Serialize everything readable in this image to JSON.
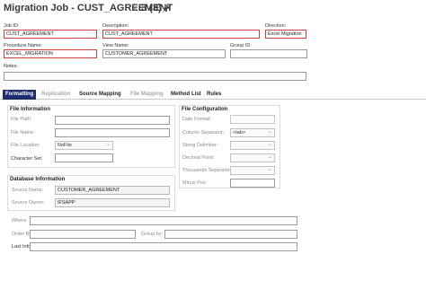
{
  "header": {
    "title": "Migration Job - CUST_AGREEMENT",
    "count": "3 (3)",
    "chevron_icon": "chevron-down-icon",
    "pin_icon": "pin-icon"
  },
  "form": {
    "job_id_label": "Job ID:",
    "job_id_value": "CUST_AGREEMENT",
    "description_label": "Description:",
    "description_value": "CUST_AGREEMENT",
    "direction_label": "Direction:",
    "direction_value": "Excel Migration",
    "procedure_label": "Procedure Name:",
    "procedure_value": "EXCEL_MIGRATION",
    "view_label": "View Name:",
    "view_value": "CUSTOMER_AGREEMENT",
    "group_label": "Group ID:",
    "group_value": "",
    "notes_label": "Notes:",
    "notes_value": ""
  },
  "tabs": [
    {
      "label": "Formatting",
      "state": "active"
    },
    {
      "label": "Replication",
      "state": "disabled"
    },
    {
      "label": "Source Mapping",
      "state": "normal"
    },
    {
      "label": "File Mapping",
      "state": "disabled"
    },
    {
      "label": "Method List",
      "state": "normal"
    },
    {
      "label": "Rules",
      "state": "normal"
    }
  ],
  "file_info": {
    "title": "File Information",
    "path_label": "File Path:",
    "name_label": "File Name:",
    "location_label": "File Location:",
    "location_value": "NoFile",
    "charset_label": "Character Set:"
  },
  "file_config": {
    "title": "File Configuration",
    "date_format_label": "Date Format:",
    "column_sep_label": "Column Separator:",
    "column_sep_value": "<tab>",
    "string_delim_label": "String Delimiter:",
    "decimal_point_label": "Decimal Point:",
    "thousands_sep_label": "Thousands Separator:",
    "minus_pos_label": "Minus Pos:"
  },
  "db_info": {
    "title": "Database Information",
    "source_name_label": "Source Name:",
    "source_name_value": "CUSTOMER_AGREEMENT",
    "source_owner_label": "Source Owner:",
    "source_owner_value": "IFSAPP"
  },
  "bottom": {
    "where_label": "Where:",
    "order_by_label": "Order By:",
    "group_by_label": "Group by:",
    "last_info_label": "Last Info:"
  }
}
